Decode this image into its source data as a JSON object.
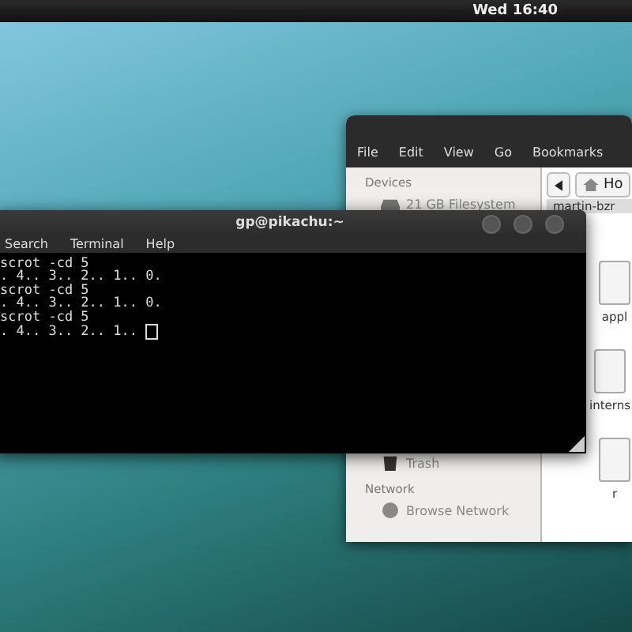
{
  "top_bar": {
    "clock": "Wed 16:40"
  },
  "file_manager": {
    "menu": [
      "File",
      "Edit",
      "View",
      "Go",
      "Bookmarks"
    ],
    "sidebar": [
      {
        "kind": "header",
        "label": "Devices"
      },
      {
        "kind": "drive",
        "label": "21 GB Filesystem"
      },
      {
        "kind": "trash",
        "label": "Trash"
      },
      {
        "kind": "header",
        "label": "Network"
      },
      {
        "kind": "network",
        "label": "Browse Network"
      }
    ],
    "location_button": "Ho",
    "path_label": "martin-bzr",
    "files": [
      "appl",
      "interns",
      "r"
    ]
  },
  "terminal": {
    "title": "gp@pikachu:~",
    "menu": [
      "Search",
      "Terminal",
      "Help"
    ],
    "lines": [
      {
        "text": "scrot -cd 5",
        "cursor": false
      },
      {
        "text": ". 4.. 3.. 2.. 1.. 0.",
        "cursor": false
      },
      {
        "text": "scrot -cd 5",
        "cursor": false
      },
      {
        "text": ". 4.. 3.. 2.. 1.. 0.",
        "cursor": false
      },
      {
        "text": "scrot -cd 5",
        "cursor": false
      },
      {
        "text": ". 4.. 3.. 2.. 1..",
        "cursor": true
      }
    ]
  }
}
